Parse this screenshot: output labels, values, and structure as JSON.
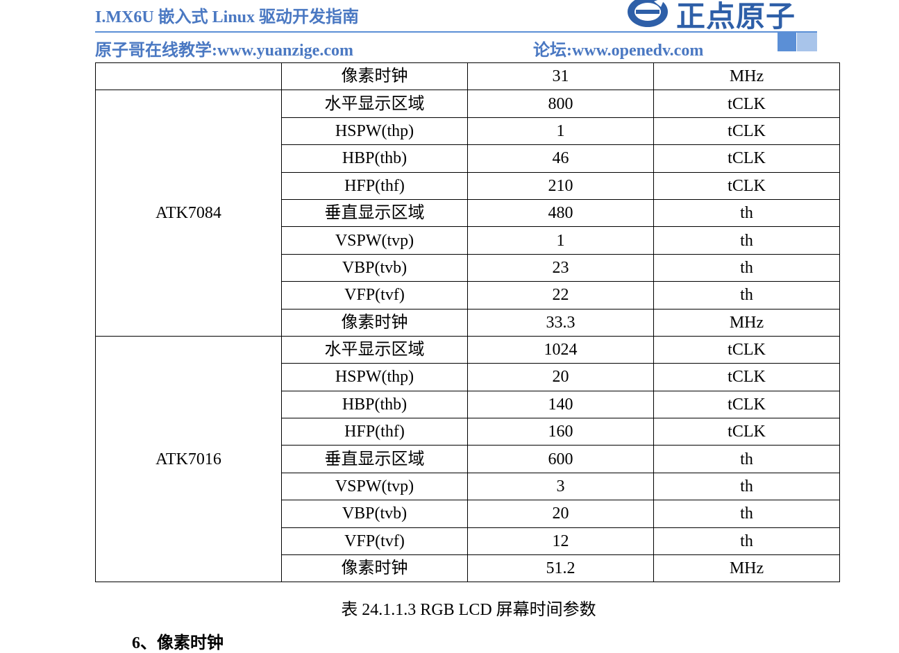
{
  "header": {
    "title": "I.MX6U 嵌入式 Linux 驱动开发指南",
    "logo_text": "正点原子",
    "site": "原子哥在线教学:www.yuanzige.com",
    "forum": "论坛:www.openedv.com"
  },
  "table": {
    "rows": [
      {
        "model": "",
        "param": "像素时钟",
        "value": "31",
        "unit": "MHz"
      },
      {
        "model": "ATK7084",
        "param": "水平显示区域",
        "value": "800",
        "unit": "tCLK"
      },
      {
        "param": "HSPW(thp)",
        "value": "1",
        "unit": "tCLK"
      },
      {
        "param": "HBP(thb)",
        "value": "46",
        "unit": "tCLK"
      },
      {
        "param": "HFP(thf)",
        "value": "210",
        "unit": "tCLK"
      },
      {
        "param": "垂直显示区域",
        "value": "480",
        "unit": "th"
      },
      {
        "param": "VSPW(tvp)",
        "value": "1",
        "unit": "th"
      },
      {
        "param": "VBP(tvb)",
        "value": "23",
        "unit": "th"
      },
      {
        "param": "VFP(tvf)",
        "value": "22",
        "unit": "th"
      },
      {
        "param": "像素时钟",
        "value": "33.3",
        "unit": "MHz"
      },
      {
        "model": "ATK7016",
        "param": "水平显示区域",
        "value": "1024",
        "unit": "tCLK"
      },
      {
        "param": "HSPW(thp)",
        "value": "20",
        "unit": "tCLK"
      },
      {
        "param": "HBP(thb)",
        "value": "140",
        "unit": "tCLK"
      },
      {
        "param": "HFP(thf)",
        "value": "160",
        "unit": "tCLK"
      },
      {
        "param": "垂直显示区域",
        "value": "600",
        "unit": "th"
      },
      {
        "param": "VSPW(tvp)",
        "value": "3",
        "unit": "th"
      },
      {
        "param": "VBP(tvb)",
        "value": "20",
        "unit": "th"
      },
      {
        "param": "VFP(tvf)",
        "value": "12",
        "unit": "th"
      },
      {
        "param": "像素时钟",
        "value": "51.2",
        "unit": "MHz"
      }
    ]
  },
  "caption": "表 24.1.1.3 RGB LCD 屏幕时间参数",
  "next_section": "6、像素时钟",
  "colors": {
    "header_blue": "#4a78c2",
    "logo_blue": "#2e5fa8",
    "rule_blue": "#5b8fd6"
  }
}
